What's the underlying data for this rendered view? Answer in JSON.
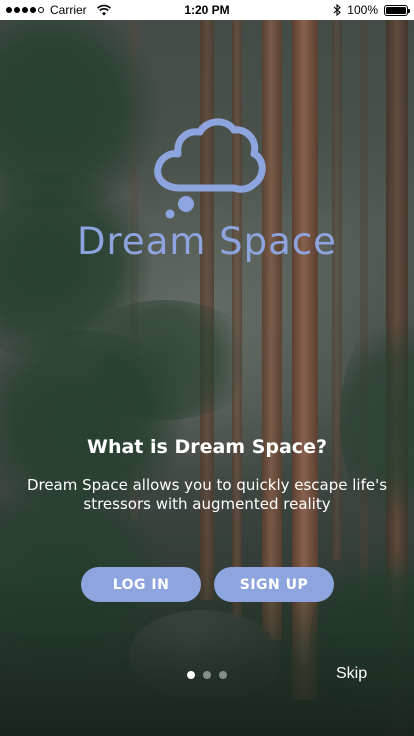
{
  "status_bar": {
    "carrier": "Carrier",
    "time": "1:20 PM",
    "battery_text": "100%",
    "battery_level": 1.0,
    "signal_bars_filled": 4,
    "signal_bars_total": 5
  },
  "brand": {
    "name": "Dream Space",
    "logo_icon": "cloud-thought-icon",
    "accent_color": "#8ea4df"
  },
  "intro": {
    "title": "What is Dream Space?",
    "description": "Dream Space allows you to quickly escape life's stressors with augmented reality"
  },
  "actions": {
    "login_label": "LOG IN",
    "signup_label": "SIGN UP",
    "skip_label": "Skip"
  },
  "pager": {
    "total": 3,
    "active_index": 0
  }
}
